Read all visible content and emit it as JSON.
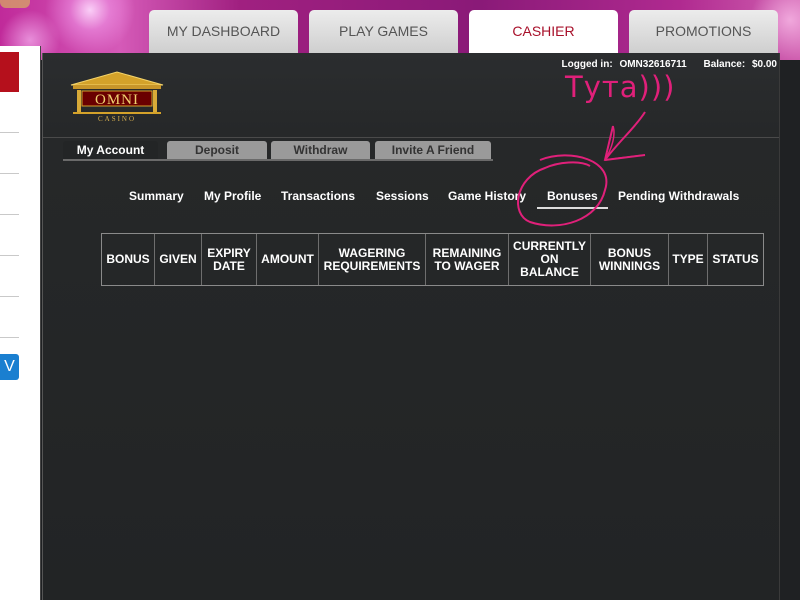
{
  "nav": {
    "tabs": [
      {
        "label": "MY DASHBOARD"
      },
      {
        "label": "PLAY GAMES"
      },
      {
        "label": "CASHIER"
      },
      {
        "label": "PROMOTIONS"
      }
    ],
    "active_index": 2
  },
  "left_sidebar": {
    "button_label": "V"
  },
  "header": {
    "logo_alt": "OMNI CASINO",
    "logged_in_label": "Logged in:",
    "username": "OMN32616711",
    "balance_label": "Balance:",
    "balance_value": "$0.00"
  },
  "sub_tabs": [
    {
      "label": "My Account"
    },
    {
      "label": "Deposit"
    },
    {
      "label": "Withdraw"
    },
    {
      "label": "Invite A Friend"
    }
  ],
  "account_links": [
    {
      "label": "Summary"
    },
    {
      "label": "My Profile"
    },
    {
      "label": "Transactions"
    },
    {
      "label": "Sessions"
    },
    {
      "label": "Game History"
    },
    {
      "label": "Bonuses"
    },
    {
      "label": "Pending Withdrawals"
    }
  ],
  "table": {
    "headers": [
      "BONUS",
      "GIVEN",
      "EXPIRY\nDATE",
      "AMOUNT",
      "WAGERING\nREQUIREMENTS",
      "REMAINING\nTO WAGER",
      "CURRENTLY\nON\nBALANCE",
      "BONUS\nWINNINGS",
      "TYPE",
      "STATUS"
    ]
  },
  "annotation": {
    "text": "Тута)))",
    "color": "#e0207a"
  },
  "colors": {
    "active_tab_text": "#a8102a",
    "panel_bg": "#262829"
  }
}
